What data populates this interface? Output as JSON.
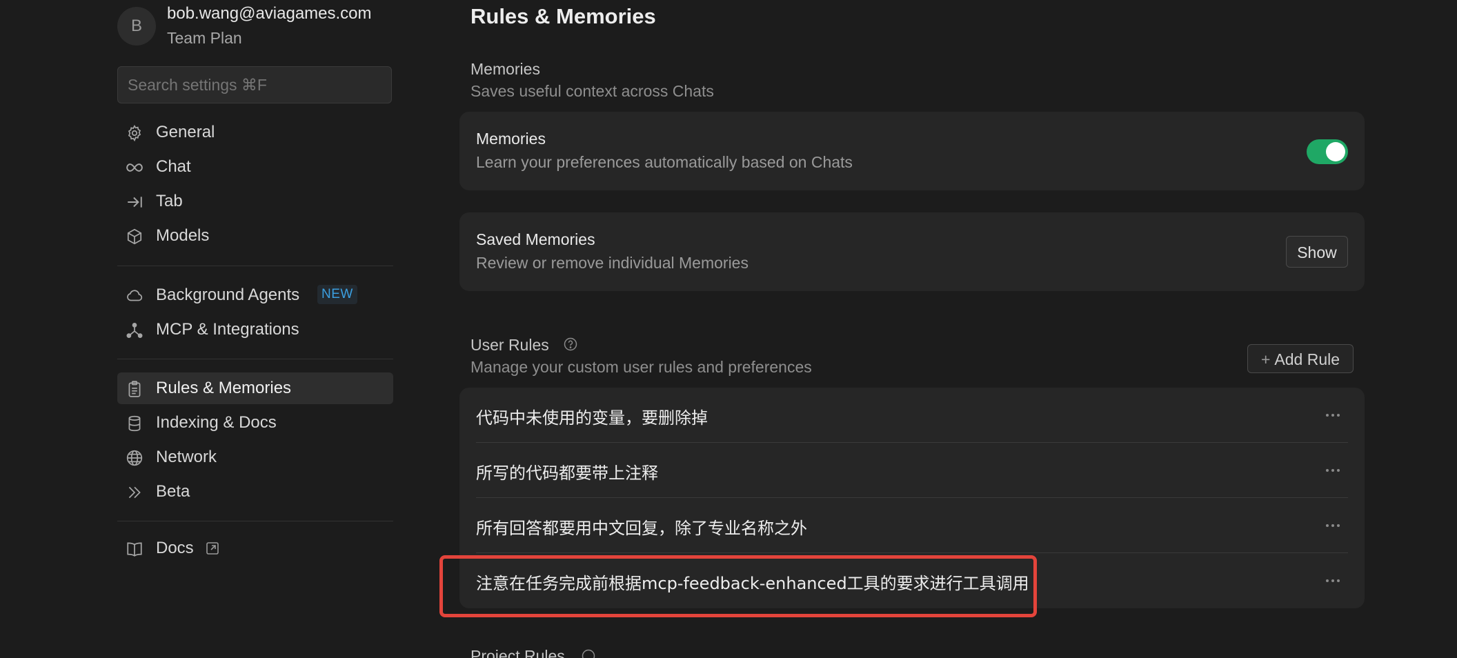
{
  "account": {
    "avatar_initial": "B",
    "email": "bob.wang@aviagames.com",
    "plan": "Team Plan"
  },
  "search": {
    "placeholder": "Search settings ⌘F"
  },
  "sidebar": {
    "group1": [
      {
        "label": "General",
        "icon": "gear-icon"
      },
      {
        "label": "Chat",
        "icon": "infinity-icon"
      },
      {
        "label": "Tab",
        "icon": "tab-arrow-icon"
      },
      {
        "label": "Models",
        "icon": "cube-icon"
      }
    ],
    "group2": [
      {
        "label": "Background Agents",
        "icon": "cloud-icon",
        "badge": "NEW"
      },
      {
        "label": "MCP & Integrations",
        "icon": "nodes-icon"
      }
    ],
    "group3": [
      {
        "label": "Rules & Memories",
        "icon": "clipboard-icon",
        "active": true
      },
      {
        "label": "Indexing & Docs",
        "icon": "database-icon"
      },
      {
        "label": "Network",
        "icon": "globe-icon"
      },
      {
        "label": "Beta",
        "icon": "double-chevron-icon"
      }
    ],
    "group4": [
      {
        "label": "Docs",
        "icon": "book-icon",
        "external_icon": "external-link-icon"
      }
    ]
  },
  "main": {
    "title": "Rules & Memories",
    "memories_section": {
      "label": "Memories",
      "desc": "Saves useful context across Chats"
    },
    "memories_card": {
      "title": "Memories",
      "desc": "Learn your preferences automatically based on Chats",
      "toggle_on": true,
      "toggle_color": "#1fa865"
    },
    "saved_card": {
      "title": "Saved Memories",
      "desc": "Review or remove individual Memories",
      "button": "Show"
    },
    "user_rules": {
      "label": "User Rules",
      "desc": "Manage your custom user rules and preferences",
      "add_button": "Add Rule",
      "rules": [
        "代码中未使用的变量，要删除掉",
        "所写的代码都要带上注释",
        "所有回答都要用中文回复，除了专业名称之外",
        "注意在任务完成前根据mcp-feedback-enhanced工具的要求进行工具调用"
      ],
      "highlight_color": "#e3443b"
    },
    "project_rules": {
      "label": "Project Rules"
    }
  }
}
